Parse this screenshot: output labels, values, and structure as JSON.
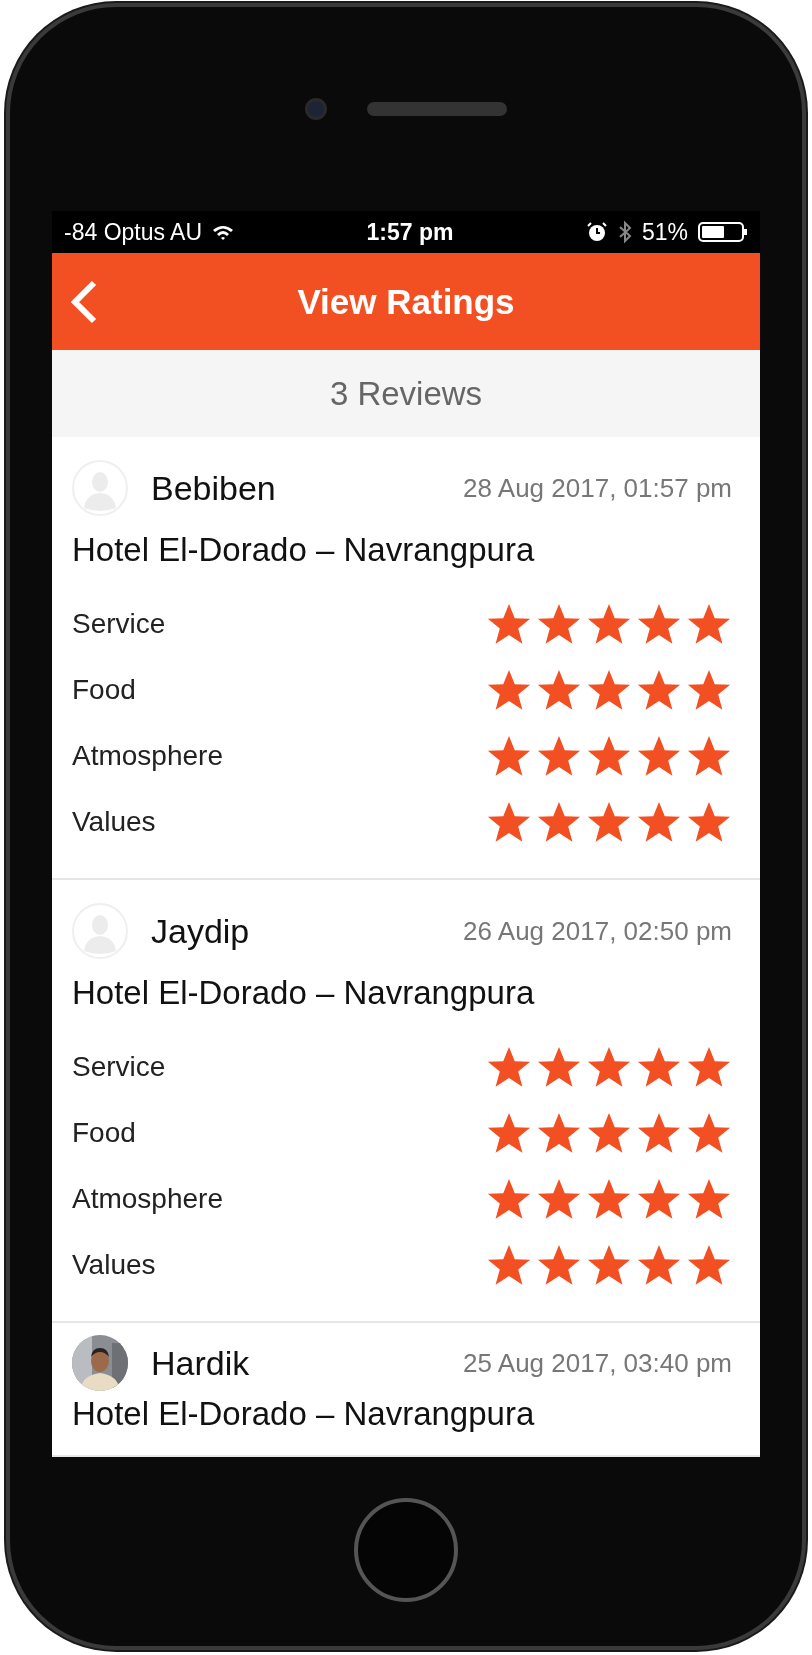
{
  "status_bar": {
    "carrier": "-84 Optus AU",
    "time": "1:57 pm",
    "battery": "51%"
  },
  "header": {
    "title": "View Ratings"
  },
  "summary": "3 Reviews",
  "reviews": [
    {
      "name": "Bebiben",
      "date": "28 Aug 2017, 01:57 pm",
      "avatar": {
        "kind": "placeholder"
      },
      "hotel": "Hotel El-Dorado – Navrangpura",
      "ratings": [
        {
          "label": "Service",
          "stars": 5
        },
        {
          "label": "Food",
          "stars": 5
        },
        {
          "label": "Atmosphere",
          "stars": 5
        },
        {
          "label": "Values",
          "stars": 5
        }
      ]
    },
    {
      "name": "Jaydip",
      "date": "26 Aug 2017, 02:50 pm",
      "avatar": {
        "kind": "placeholder"
      },
      "hotel": "Hotel El-Dorado – Navrangpura",
      "ratings": [
        {
          "label": "Service",
          "stars": 5
        },
        {
          "label": "Food",
          "stars": 5
        },
        {
          "label": "Atmosphere",
          "stars": 5
        },
        {
          "label": "Values",
          "stars": 5
        }
      ]
    },
    {
      "name": "Hardik",
      "date": "25 Aug 2017, 03:40 pm",
      "hotel": "Hotel El-Dorado – Navrangpura"
    }
  ]
}
